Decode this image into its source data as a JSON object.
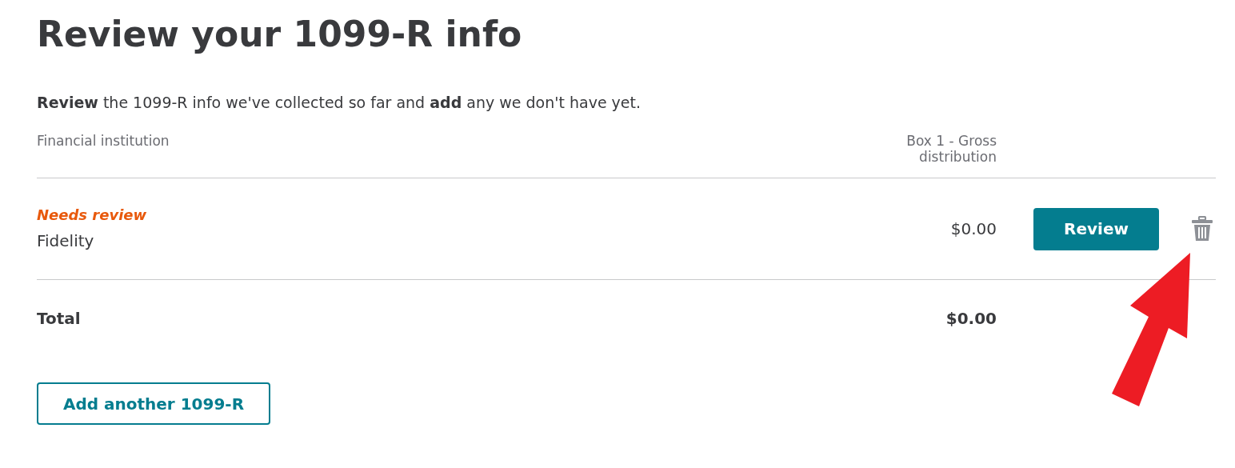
{
  "title": "Review your 1099-R info",
  "intro": "**Review** the 1099-R info we've collected so far and **add** any we don't have yet.",
  "table": {
    "columns": [
      "Financial institution",
      "Box 1 - Gross distribution"
    ],
    "rows": [
      {
        "status": "Needs review",
        "name": "Fidelity",
        "amount": "$0.00",
        "button": "Review"
      }
    ],
    "total": {
      "label": "Total",
      "amount": "$0.00"
    }
  },
  "add_button": "Add another 1099-R"
}
